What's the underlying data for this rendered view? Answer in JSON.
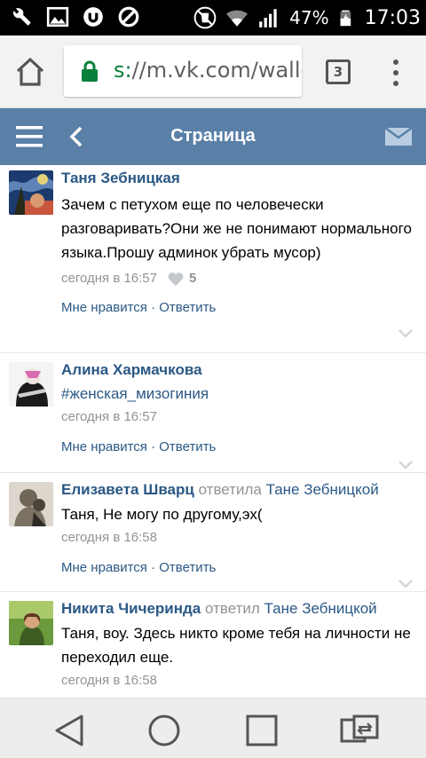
{
  "status_bar": {
    "battery_percent": "47%",
    "time": "17:03",
    "left_icons": [
      "wrench-icon",
      "image-icon",
      "vpn-icon",
      "blocked-icon"
    ],
    "right_icons": [
      "mute-icon",
      "wifi-icon",
      "signal-icon",
      "battery-charging-icon"
    ]
  },
  "browser": {
    "url_scheme": "s:",
    "url_rest": "//m.vk.com/wall-",
    "tab_count": "3"
  },
  "header": {
    "title": "Страница"
  },
  "comments": [
    {
      "author": "Таня Зебницкая",
      "text": "Зачем с петухом еще по человечески разговаривать?Они же не понимают нормального языка.Прошу админок убрать мусор)",
      "time": "сегодня в 16:57",
      "likes": "5",
      "actions": "Мне нравится · Ответить"
    },
    {
      "author": "Алина Хармачкова",
      "text": "#женская_мизогиния",
      "time": "сегодня в 16:57",
      "actions": "Мне нравится · Ответить"
    },
    {
      "author": "Елизавета Шварц",
      "replied": "ответила",
      "reply_to": "Тане Зебницкой",
      "text": "Таня, Не могу по другому,эх(",
      "time": "сегодня в 16:58",
      "actions": "Мне нравится · Ответить"
    },
    {
      "author": "Никита Чичеринда",
      "replied": "ответил",
      "reply_to": "Тане Зебницкой",
      "text": "Таня, воу. Здесь никто кроме тебя на личности не переходил еще.",
      "time": "сегодня в 16:58"
    }
  ],
  "colors": {
    "vk_header": "#5a80a8",
    "link": "#2a5885",
    "meta": "#939393"
  }
}
